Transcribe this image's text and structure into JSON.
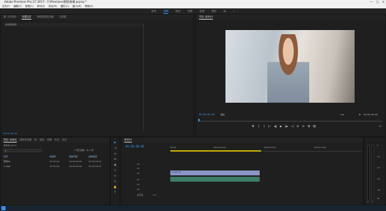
{
  "window": {
    "title": "Adobe Premiere Pro CC 2017 - F:\\Premiere视频\\剪辑.prproj *",
    "controls": [
      "—",
      "□",
      "✕"
    ]
  },
  "menu": [
    "文件(F)",
    "编辑(E)",
    "剪辑(C)",
    "序列(S)",
    "标记(M)",
    "图形(G)",
    "窗口(W)",
    "帮助(H)"
  ],
  "workspaces": {
    "items": [
      "组件",
      "编辑",
      "颜色",
      "效果",
      "音频",
      "图形",
      "库",
      "»"
    ],
    "active_index": 1
  },
  "source_panel": {
    "tabs": [
      "源: (无剪辑)",
      "效果控件",
      "音频剪辑混合器",
      "元数据"
    ],
    "active_tab": 1,
    "message": "(未选择剪辑)",
    "timecode": "00:00:00:00"
  },
  "program_panel": {
    "tab": "节目: 序列01",
    "timecode_left": "00:00:00:00",
    "fit": "适合",
    "quality": "1/2",
    "timecode_right": "00:00:05:00",
    "controls": [
      "▼",
      "{",
      "}",
      "|←",
      "◀|",
      "▶",
      "|▶",
      "→|",
      "⊞",
      "⊟",
      "⧉",
      "📷"
    ]
  },
  "project_panel": {
    "tabs": [
      "项目: 未命名",
      "媒体浏览器",
      "库",
      "信息",
      "效果",
      "标记",
      "历史"
    ],
    "active_tab": 0,
    "path": "未命名.prproj",
    "count": "1 项已选择，共 2 项",
    "search_placeholder": "",
    "columns": [
      "名称",
      "帧速率",
      "媒体开始",
      "媒体结束"
    ],
    "rows": [
      {
        "name": "序列01",
        "fps": "25.00 fps",
        "start": "00:00:00:00",
        "end": "00:00:04:24"
      },
      {
        "name": "1.mp4",
        "fps": "25.00 fps",
        "start": "00:00:00:00",
        "end": "00:00:04:24"
      }
    ]
  },
  "timeline": {
    "tab": "序列01",
    "timecode": "00:00:00:00",
    "ruler": [
      "00:00",
      "00:00:05:00",
      "00:00:10:00",
      "00:00:15:00"
    ],
    "tracks": [
      "V3",
      "V2",
      "V1",
      "A1",
      "A2",
      "A3"
    ],
    "master": "主声道",
    "master_value": "0.0",
    "clip_label": "1.mp4 [V]"
  },
  "audio_meter": {
    "labels": [
      "0",
      "-12",
      "-24",
      "-36",
      "-48",
      "dB"
    ],
    "solo": [
      "S",
      "S"
    ]
  },
  "tools": [
    "▶",
    "⇥",
    "⇔",
    "⇹",
    "◆",
    "✂",
    "↔",
    "✎",
    "✋",
    "T"
  ]
}
